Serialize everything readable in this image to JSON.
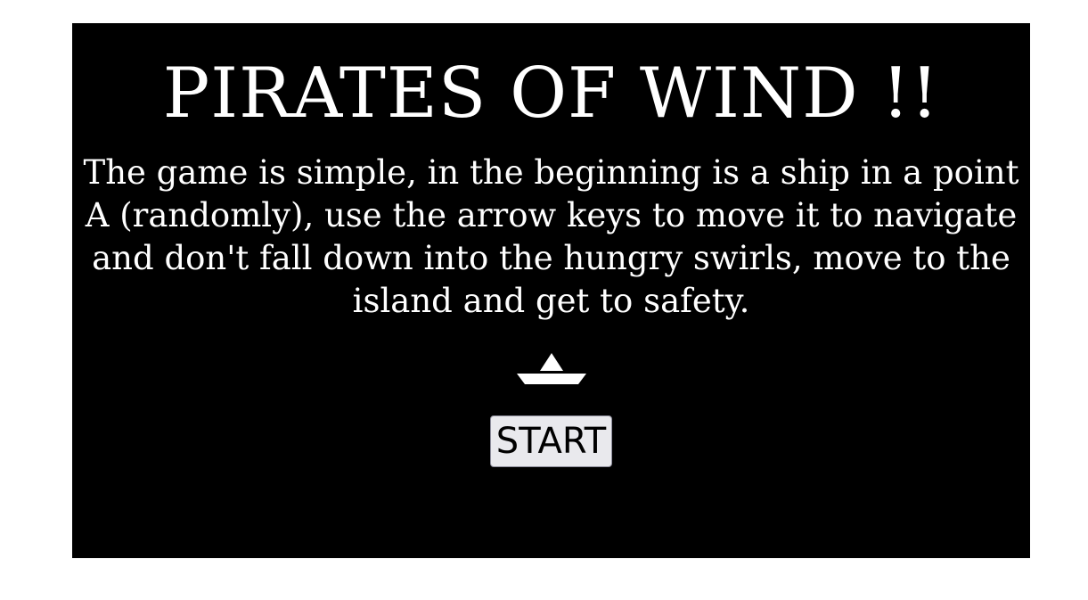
{
  "game": {
    "title": "PIRATES OF WIND !!",
    "description": "The game is simple, in the beginning is a ship in a point A (randomly), use the arrow keys to move it to navigate and don't fall down into the hungry swirls, move to the island and get to safety.",
    "start_label": "START",
    "ship_icon": "paper-boat-icon"
  },
  "colors": {
    "panel_background": "#000000",
    "text": "#ffffff",
    "page_background": "#ffffff",
    "button_background": "#e9e9ed"
  }
}
